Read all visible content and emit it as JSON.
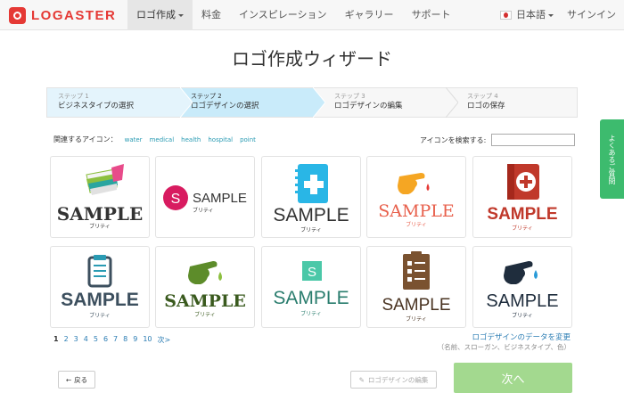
{
  "brand": {
    "name": "LOGASTER",
    "color": "#e53935"
  },
  "nav": {
    "items": [
      {
        "label": "ロゴ作成",
        "active": true,
        "dropdown": true
      },
      {
        "label": "料金"
      },
      {
        "label": "インスピレーション"
      },
      {
        "label": "ギャラリー"
      },
      {
        "label": "サポート"
      }
    ],
    "language": "日本語",
    "signin": "サインイン"
  },
  "page_title": "ロゴ作成ウィザード",
  "steps": [
    {
      "num": "ステップ 1",
      "name": "ビジネスタイプの選択",
      "state": "done"
    },
    {
      "num": "ステップ 2",
      "name": "ロゴデザインの選択",
      "state": "current"
    },
    {
      "num": "ステップ 3",
      "name": "ロゴデザインの編集",
      "state": "todo"
    },
    {
      "num": "ステップ 4",
      "name": "ロゴの保存",
      "state": "todo"
    }
  ],
  "related": {
    "label": "関連するアイコン：",
    "tags": [
      "water",
      "medical",
      "health",
      "hospital",
      "point"
    ]
  },
  "search": {
    "label": "アイコンを検索する:",
    "value": "",
    "placeholder": ""
  },
  "logos": [
    {
      "icon": "pill-box-icon",
      "text": "SAMPLE",
      "tagline": "ブリティ",
      "text_color": "#222222"
    },
    {
      "icon": "letter-s-circle-icon",
      "text": "SAMPLE",
      "tagline": "ブリティ",
      "text_color": "#333333"
    },
    {
      "icon": "notebook-plus-icon",
      "text": "SAMPLE",
      "tagline": "ブリティ",
      "text_color": "#333333"
    },
    {
      "icon": "pointing-hand-drop-icon",
      "text": "SAMPLE",
      "tagline": "ブリティ",
      "text_color": "#e8604c"
    },
    {
      "icon": "first-aid-book-icon",
      "text": "SAMPLE",
      "tagline": "ブリティ",
      "text_color": "#c0392b"
    },
    {
      "icon": "clipboard-icon",
      "text": "SAMPLE",
      "tagline": "ブリティ",
      "text_color": "#3c4f5e"
    },
    {
      "icon": "pointing-hand-drop-icon",
      "text": "SAMPLE",
      "tagline": "ブリティ",
      "text_color": "#3a5a1e"
    },
    {
      "icon": "letter-s-square-icon",
      "text": "SAMPLE",
      "tagline": "ブリティ",
      "text_color": "#2a7d6e"
    },
    {
      "icon": "checklist-icon",
      "text": "SAMPLE",
      "tagline": "ブリティ",
      "text_color": "#4a3422"
    },
    {
      "icon": "pointing-hand-drop-icon",
      "text": "SAMPLE",
      "tagline": "ブリティ",
      "text_color": "#1f2d3d"
    }
  ],
  "pagination": {
    "pages": [
      "1",
      "2",
      "3",
      "4",
      "5",
      "6",
      "7",
      "8",
      "9",
      "10",
      "次>"
    ],
    "current": "1"
  },
  "edit_data": {
    "link": "ロゴデザインのデータを変更",
    "sub": "（名前、スローガン、ビジネスタイプ、色）"
  },
  "buttons": {
    "back": "戻る",
    "edit": "ロゴデザインの編集",
    "next": "次へ"
  },
  "side_tab": "よくあるご質問",
  "colors": {
    "accent": "#2a9bb3",
    "next_button": "#a3d98f",
    "side_tab": "#3dbb6e"
  }
}
